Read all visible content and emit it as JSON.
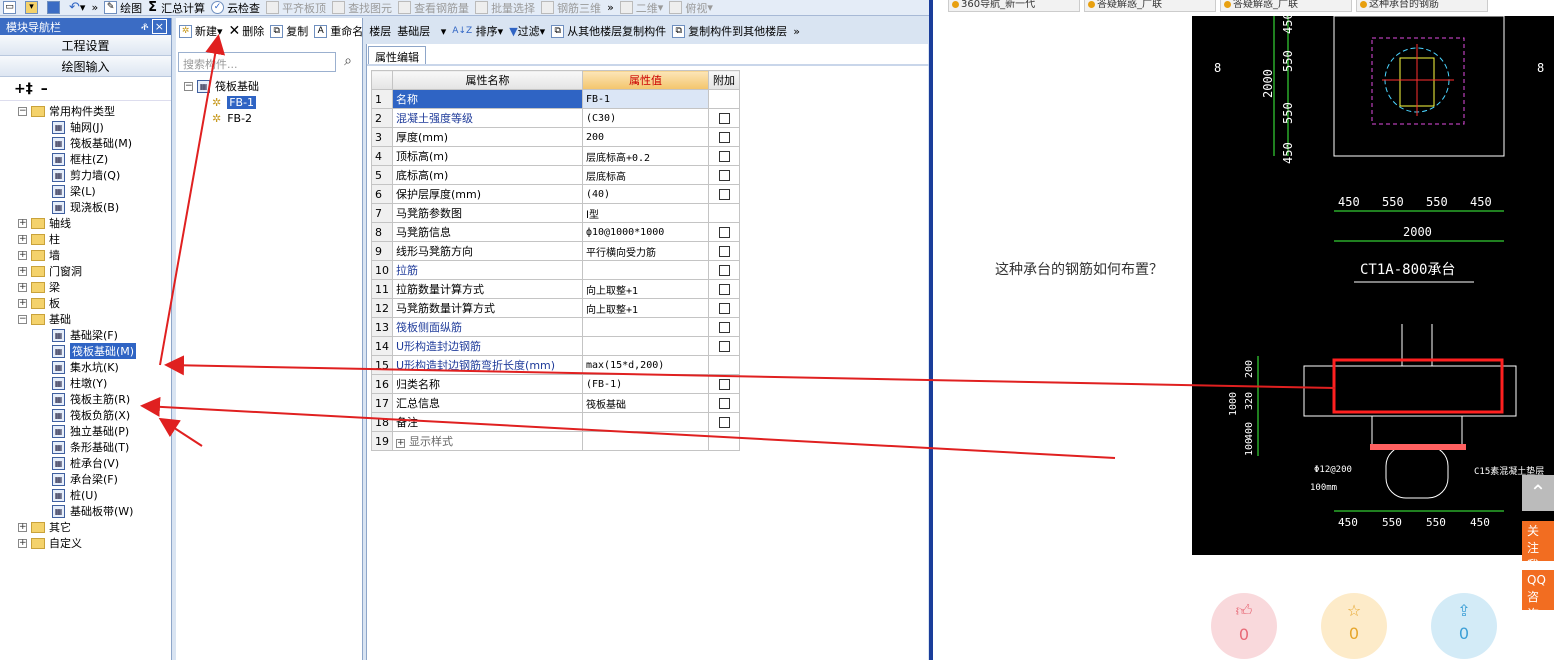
{
  "toolbar": {
    "items": [
      {
        "label": "绘图",
        "enabled": true
      },
      {
        "label": "汇总计算",
        "enabled": true
      },
      {
        "label": "云检查",
        "enabled": true
      },
      {
        "label": "平齐板顶",
        "enabled": false
      },
      {
        "label": "查找图元",
        "enabled": false
      },
      {
        "label": "查看钢筋量",
        "enabled": false
      },
      {
        "label": "批量选择",
        "enabled": false
      },
      {
        "label": "钢筋三维",
        "enabled": false
      },
      {
        "label": "二维",
        "enabled": false
      },
      {
        "label": "俯视",
        "enabled": false
      }
    ]
  },
  "nav": {
    "title": "模块导航栏",
    "pin": "ቶ",
    "close": "×",
    "buttons": [
      "工程设置",
      "绘图输入"
    ],
    "tree": [
      {
        "label": "常用构件类型",
        "level": 0,
        "type": "folder",
        "expanded": true
      },
      {
        "label": "轴网(J)",
        "level": 1,
        "type": "item"
      },
      {
        "label": "筏板基础(M)",
        "level": 1,
        "type": "item"
      },
      {
        "label": "框柱(Z)",
        "level": 1,
        "type": "item"
      },
      {
        "label": "剪力墙(Q)",
        "level": 1,
        "type": "item"
      },
      {
        "label": "梁(L)",
        "level": 1,
        "type": "item"
      },
      {
        "label": "现浇板(B)",
        "level": 1,
        "type": "item"
      },
      {
        "label": "轴线",
        "level": 0,
        "type": "folder",
        "expanded": false
      },
      {
        "label": "柱",
        "level": 0,
        "type": "folder",
        "expanded": false
      },
      {
        "label": "墙",
        "level": 0,
        "type": "folder",
        "expanded": false
      },
      {
        "label": "门窗洞",
        "level": 0,
        "type": "folder",
        "expanded": false
      },
      {
        "label": "梁",
        "level": 0,
        "type": "folder",
        "expanded": false
      },
      {
        "label": "板",
        "level": 0,
        "type": "folder",
        "expanded": false
      },
      {
        "label": "基础",
        "level": 0,
        "type": "folder",
        "expanded": true
      },
      {
        "label": "基础梁(F)",
        "level": 1,
        "type": "item"
      },
      {
        "label": "筏板基础(M)",
        "level": 1,
        "type": "item",
        "selected": true
      },
      {
        "label": "集水坑(K)",
        "level": 1,
        "type": "item"
      },
      {
        "label": "柱墩(Y)",
        "level": 1,
        "type": "item"
      },
      {
        "label": "筏板主筋(R)",
        "level": 1,
        "type": "item"
      },
      {
        "label": "筏板负筋(X)",
        "level": 1,
        "type": "item"
      },
      {
        "label": "独立基础(P)",
        "level": 1,
        "type": "item"
      },
      {
        "label": "条形基础(T)",
        "level": 1,
        "type": "item"
      },
      {
        "label": "桩承台(V)",
        "level": 1,
        "type": "item"
      },
      {
        "label": "承台梁(F)",
        "level": 1,
        "type": "item"
      },
      {
        "label": "桩(U)",
        "level": 1,
        "type": "item"
      },
      {
        "label": "基础板带(W)",
        "level": 1,
        "type": "item"
      },
      {
        "label": "其它",
        "level": 0,
        "type": "folder",
        "expanded": false
      },
      {
        "label": "自定义",
        "level": 0,
        "type": "folder",
        "expanded": false
      }
    ]
  },
  "comp": {
    "tools": [
      {
        "label": "新建",
        "dropdown": true
      },
      {
        "label": "删除"
      },
      {
        "label": "复制"
      },
      {
        "label": "重命名"
      },
      {
        "label": "楼层",
        "static": true
      },
      {
        "label": "基础层",
        "dropdown": true
      },
      {
        "label": "排序",
        "dropdown": true
      },
      {
        "label": "过滤",
        "dropdown": true
      },
      {
        "label": "从其他楼层复制构件"
      },
      {
        "label": "复制构件到其他楼层"
      }
    ],
    "search_placeholder": "搜索构件...",
    "root": "筏板基础",
    "items": [
      {
        "label": "FB-1",
        "selected": true
      },
      {
        "label": "FB-2",
        "selected": false
      }
    ]
  },
  "props": {
    "tab": "属性编辑",
    "headers": [
      "属性名称",
      "属性值",
      "附加"
    ],
    "rows": [
      {
        "n": "1",
        "name": "名称",
        "value": "FB-1",
        "checkbox": false,
        "blue": false,
        "selected": true
      },
      {
        "n": "2",
        "name": "混凝土强度等级",
        "value": "(C30)",
        "checkbox": true,
        "blue": true
      },
      {
        "n": "3",
        "name": "厚度(mm)",
        "value": "200",
        "checkbox": true,
        "blue": false
      },
      {
        "n": "4",
        "name": "顶标高(m)",
        "value": "层底标高+0.2",
        "checkbox": true,
        "blue": false
      },
      {
        "n": "5",
        "name": "底标高(m)",
        "value": "层底标高",
        "checkbox": true,
        "blue": false
      },
      {
        "n": "6",
        "name": "保护层厚度(mm)",
        "value": "(40)",
        "checkbox": true,
        "blue": false
      },
      {
        "n": "7",
        "name": "马凳筋参数图",
        "value": "Ⅰ型",
        "checkbox": false,
        "blue": false
      },
      {
        "n": "8",
        "name": "马凳筋信息",
        "value": "ф10@1000*1000",
        "checkbox": true,
        "blue": false
      },
      {
        "n": "9",
        "name": "线形马凳筋方向",
        "value": "平行横向受力筋",
        "checkbox": true,
        "blue": false
      },
      {
        "n": "10",
        "name": "拉筋",
        "value": "",
        "checkbox": true,
        "blue": true
      },
      {
        "n": "11",
        "name": "拉筋数量计算方式",
        "value": "向上取整+1",
        "checkbox": true,
        "blue": false
      },
      {
        "n": "12",
        "name": "马凳筋数量计算方式",
        "value": "向上取整+1",
        "checkbox": true,
        "blue": false
      },
      {
        "n": "13",
        "name": "筏板侧面纵筋",
        "value": "",
        "checkbox": true,
        "blue": true
      },
      {
        "n": "14",
        "name": "U形构造封边钢筋",
        "value": "",
        "checkbox": true,
        "blue": true
      },
      {
        "n": "15",
        "name": "U形构造封边钢筋弯折长度(mm)",
        "value": "max(15*d,200)",
        "checkbox": false,
        "blue": true
      },
      {
        "n": "16",
        "name": "归类名称",
        "value": "(FB-1)",
        "checkbox": true,
        "blue": false
      },
      {
        "n": "17",
        "name": "汇总信息",
        "value": "筏板基础",
        "checkbox": true,
        "blue": false
      },
      {
        "n": "18",
        "name": "备注",
        "value": "",
        "checkbox": true,
        "blue": false
      },
      {
        "n": "19",
        "name": "显示样式",
        "value": "",
        "checkbox": false,
        "blue": false,
        "expander": true
      }
    ]
  },
  "browser": {
    "tabs": [
      "360导航_新一代",
      "答疑解惑_广联",
      "答疑解惑_广联",
      "这种承台的钢筋"
    ],
    "question": "这种承台的钢筋如何布置？",
    "follow": "关注我们",
    "qq": "QQ咨询",
    "stats": [
      {
        "icon": "thumb-up",
        "count": "0",
        "color": "#f9d9dc",
        "fg": "#e86a77"
      },
      {
        "icon": "star",
        "count": "0",
        "color": "#fdebc9",
        "fg": "#e6a52a"
      },
      {
        "icon": "share",
        "count": "0",
        "color": "#d3ebf7",
        "fg": "#3c9fd6"
      }
    ]
  },
  "cad": {
    "dims_top_vertical": [
      "450",
      "550",
      "550",
      "450"
    ],
    "total_vertical": "2000",
    "dims_horizontal": [
      "450",
      "550",
      "550",
      "450"
    ],
    "total_horizontal": "2000",
    "title": "CT1A-800承台",
    "side_label": "8",
    "section_vertical": [
      "200",
      "320",
      "400",
      "100"
    ],
    "section_total": "1000",
    "annotations": [
      "Φ12@200",
      "C15素混凝土垫层",
      "100mm"
    ],
    "bottom_dims": [
      "450",
      "550",
      "550",
      "450"
    ]
  }
}
